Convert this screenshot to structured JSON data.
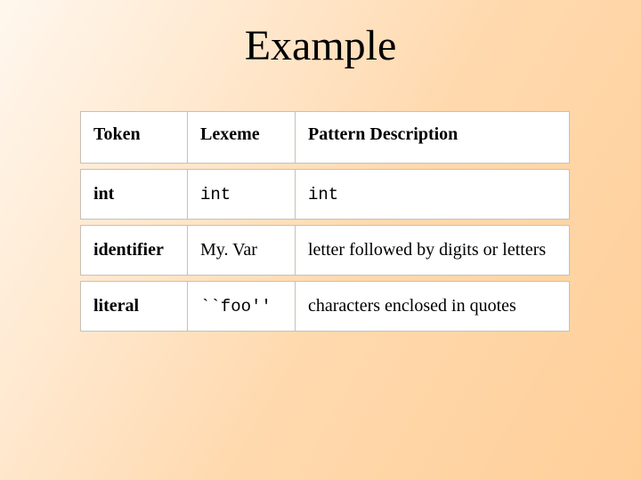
{
  "title": "Example",
  "table": {
    "headers": [
      "Token",
      "Lexeme",
      "Pattern Description"
    ],
    "rows": [
      {
        "token": "int",
        "lexeme": "int",
        "pattern": "int",
        "lexeme_mono": true,
        "pattern_mono": true
      },
      {
        "token": "identifier",
        "lexeme": "My. Var",
        "pattern": "letter followed by digits or letters",
        "lexeme_mono": false,
        "pattern_mono": false
      },
      {
        "token": "literal",
        "lexeme": "``foo''",
        "pattern": "characters enclosed in quotes",
        "lexeme_mono": true,
        "pattern_mono": false
      }
    ]
  }
}
